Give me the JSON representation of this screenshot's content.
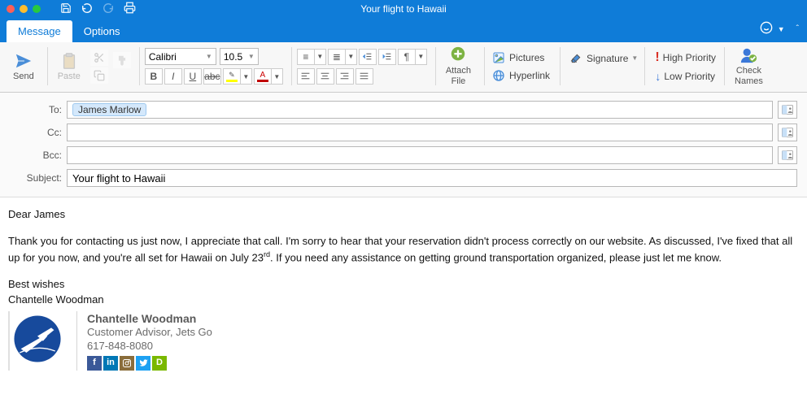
{
  "window": {
    "title": "Your flight to Hawaii"
  },
  "tabs": {
    "message": "Message",
    "options": "Options"
  },
  "ribbon": {
    "send": "Send",
    "paste": "Paste",
    "font_family": "Calibri",
    "font_size": "10.5",
    "attach_file": "Attach\nFile",
    "pictures": "Pictures",
    "signature": "Signature",
    "hyperlink": "Hyperlink",
    "high_priority": "High Priority",
    "low_priority": "Low Priority",
    "check_names": "Check\nNames"
  },
  "compose": {
    "to_label": "To:",
    "to_recipient": "James Marlow",
    "cc_label": "Cc:",
    "bcc_label": "Bcc:",
    "subject_label": "Subject:",
    "subject_value": "Your flight to Hawaii"
  },
  "body": {
    "greeting": "Dear James",
    "para_part1": "Thank you for contacting us just now, I appreciate that call. I'm sorry to hear that your reservation didn't process correctly on our website. As discussed, I've fixed that all up for you now, and you're all set for Hawaii on July 23",
    "para_sup": "rd",
    "para_part2": ". If you need any assistance on getting ground transportation organized, please just let me know.",
    "closing": "Best wishes",
    "sender_name": "Chantelle Woodman"
  },
  "signature": {
    "name": "Chantelle Woodman",
    "title": "Customer Advisor, Jets Go",
    "phone": "617-848-8080"
  }
}
